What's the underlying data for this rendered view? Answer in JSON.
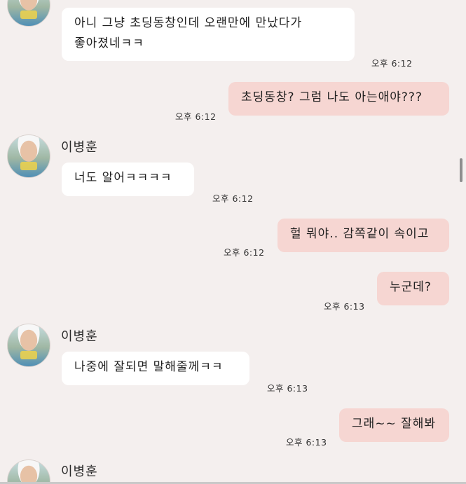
{
  "messages": {
    "m1": {
      "text": "아니 그냥 초딩동창인데 오랜만에 만났다가\n좋아졌네ㅋㅋ",
      "time": "오후 6:12"
    },
    "m2": {
      "text": "초딩동창? 그럼 나도 아는애야???",
      "time": "오후 6:12"
    },
    "m3": {
      "sender": "이병훈",
      "text": "너도 알어ㅋㅋㅋㅋ",
      "time": "오후 6:12"
    },
    "m4": {
      "text": "헐 뭐야.. 감쪽같이 속이고",
      "time": "오후 6:12"
    },
    "m5": {
      "text": "누군데?",
      "time": "오후 6:13"
    },
    "m6": {
      "sender": "이병훈",
      "text": "나중에 잘되면 말해줄께ㅋㅋ",
      "time": "오후 6:13"
    },
    "m7": {
      "text": "그래~~ 잘해봐",
      "time": "오후 6:13"
    },
    "m8": {
      "sender": "이병훈"
    }
  },
  "colors": {
    "background": "#f4efee",
    "incoming_bubble": "#ffffff",
    "outgoing_bubble": "#f6d6d2"
  }
}
